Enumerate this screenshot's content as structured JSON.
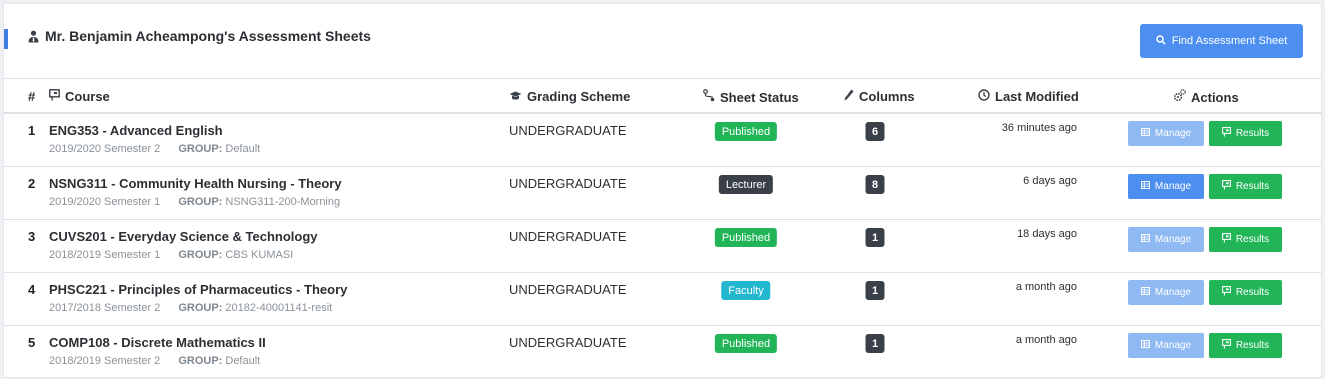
{
  "header": {
    "title": "Mr. Benjamin Acheampong's Assessment Sheets",
    "find_button": "Find Assessment Sheet"
  },
  "table": {
    "columns": {
      "index": "#",
      "course": "Course",
      "grading_scheme": "Grading Scheme",
      "sheet_status": "Sheet Status",
      "columns": "Columns",
      "last_modified": "Last Modified",
      "actions": "Actions"
    },
    "group_label": "GROUP:",
    "manage_label": "Manage",
    "results_label": "Results",
    "rows": [
      {
        "index": "1",
        "course": "ENG353 - Advanced English",
        "semester": "2019/2020 Semester 2",
        "group": "Default",
        "scheme": "UNDERGRADUATE",
        "status": "Published",
        "status_color": "#21b558",
        "columns": "6",
        "modified": "36 minutes ago",
        "manage_color": "#8fb9f3"
      },
      {
        "index": "2",
        "course": "NSNG311 - Community Health Nursing - Theory",
        "semester": "2019/2020 Semester 1",
        "group": "NSNG311-200-Morning",
        "scheme": "UNDERGRADUATE",
        "status": "Lecturer",
        "status_color": "#3a4047",
        "columns": "8",
        "modified": "6 days ago",
        "manage_color": "#4c8ff1"
      },
      {
        "index": "3",
        "course": "CUVS201 - Everyday Science & Technology",
        "semester": "2018/2019 Semester 1",
        "group": "CBS KUMASI",
        "scheme": "UNDERGRADUATE",
        "status": "Published",
        "status_color": "#21b558",
        "columns": "1",
        "modified": "18 days ago",
        "manage_color": "#8fb9f3"
      },
      {
        "index": "4",
        "course": "PHSC221 - Principles of Pharmaceutics - Theory",
        "semester": "2017/2018 Semester 2",
        "group": "20182-40001141-resit",
        "scheme": "UNDERGRADUATE",
        "status": "Faculty",
        "status_color": "#22b7cf",
        "columns": "1",
        "modified": "a month ago",
        "manage_color": "#8fb9f3"
      },
      {
        "index": "5",
        "course": "COMP108 - Discrete Mathematics II",
        "semester": "2018/2019 Semester 2",
        "group": "Default",
        "scheme": "UNDERGRADUATE",
        "status": "Published",
        "status_color": "#21b558",
        "columns": "1",
        "modified": "a month ago",
        "manage_color": "#8fb9f3"
      }
    ]
  },
  "colors": {
    "accent": "#3e7fe6",
    "primary": "#4c8ff1",
    "success": "#21b558",
    "dark": "#3a4047",
    "info": "#22b7cf"
  },
  "icons": {
    "title": "user-tie-icon",
    "find": "search-icon",
    "course": "chalkboard-icon",
    "grading": "graduation-cap-icon",
    "status": "route-icon",
    "columns": "pencil-icon",
    "modified": "clock-icon",
    "actions": "gears-icon",
    "manage": "table-icon",
    "results": "chalkboard-icon"
  }
}
